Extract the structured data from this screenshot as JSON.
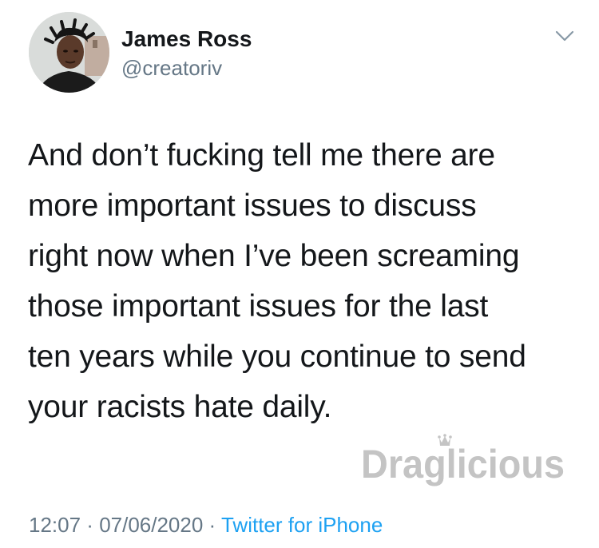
{
  "author": {
    "name": "James Ross",
    "handle": "@creatoriv"
  },
  "tweet": {
    "text": "And don’t fucking tell me there are\nmore important issues to discuss\nright now when I’ve been screaming\nthose important issues for the last\nten years while you continue to send\nyour racists hate daily."
  },
  "meta": {
    "time": "12:07",
    "separator": " · ",
    "date": "07/06/2020",
    "source": "Twitter for iPhone"
  },
  "watermark": {
    "text": "Draglicious"
  },
  "icons": {
    "menu": "chevron-down-icon",
    "crown": "crown-icon"
  },
  "colors": {
    "name": "#14171a",
    "secondary": "#657786",
    "link": "#1da1f2",
    "watermark": "#c4c4c4"
  }
}
